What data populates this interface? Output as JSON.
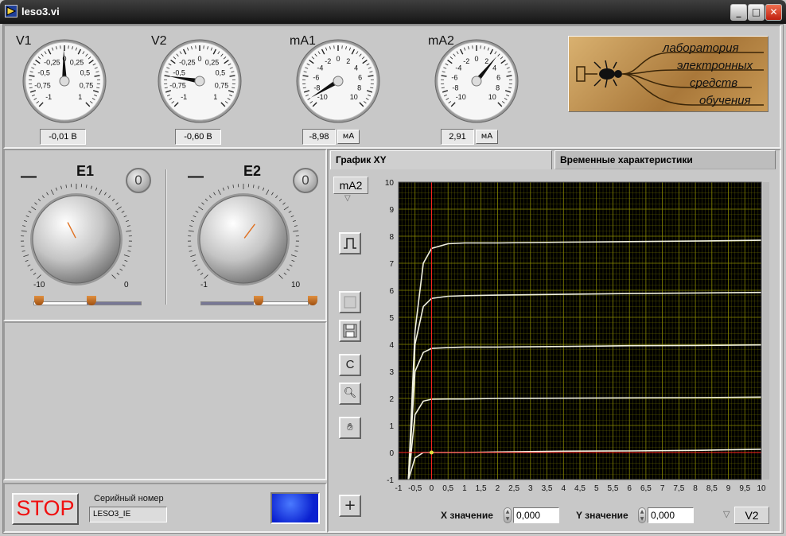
{
  "window": {
    "title": "leso3.vi",
    "minimize": "_",
    "maximize": "□",
    "close": "✕"
  },
  "gauges": [
    {
      "label": "V1",
      "ticks": [
        "-0,25",
        "0",
        "0,25",
        "-0,5",
        "0,5",
        "-0,75",
        "0,75",
        "-1",
        "1"
      ],
      "needle": -0.01,
      "min": -1,
      "max": 1,
      "display": "-0,01 В",
      "unit": ""
    },
    {
      "label": "V2",
      "ticks": [
        "-0,25",
        "0",
        "0,25",
        "-0,5",
        "0,5",
        "-0,75",
        "0,75",
        "-1",
        "1"
      ],
      "needle": -0.6,
      "min": -1,
      "max": 1,
      "display": "-0,60 В",
      "unit": ""
    },
    {
      "label": "mA1",
      "ticks": [
        "-2",
        "0",
        "2",
        "-4",
        "4",
        "-6",
        "6",
        "-8",
        "8",
        "-10",
        "10"
      ],
      "needle": -8.98,
      "min": -10,
      "max": 10,
      "display": "-8,98",
      "unit": "мА"
    },
    {
      "label": "mA2",
      "ticks": [
        "-2",
        "0",
        "2",
        "-4",
        "4",
        "-6",
        "6",
        "-8",
        "8",
        "-10",
        "10"
      ],
      "needle": 2.91,
      "min": -10,
      "max": 10,
      "display": "2,91",
      "unit": "мА"
    }
  ],
  "logo": {
    "lines": [
      "лаборатория",
      "электронных",
      "средств",
      "обучения"
    ]
  },
  "knobs": [
    {
      "label": "E1",
      "min_label": "-10",
      "max_label": "0",
      "reset": "0",
      "minus": "—",
      "value": -6
    },
    {
      "label": "E2",
      "min_label": "-1",
      "max_label": "10",
      "reset": "0",
      "minus": "—",
      "value": 6
    }
  ],
  "stop_label": "STOP",
  "serial": {
    "label": "Серийный номер",
    "value": "LESO3_IE"
  },
  "tabs": [
    {
      "label": "График XY"
    },
    {
      "label": "Временные характеристики"
    }
  ],
  "graph": {
    "y_channel": "mA2",
    "x_channel": "V2",
    "x_ticks": [
      "-1",
      "-0,5",
      "0",
      "0,5",
      "1",
      "1,5",
      "2",
      "2,5",
      "3",
      "3,5",
      "4",
      "4,5",
      "5",
      "5,5",
      "6",
      "6,5",
      "7",
      "7,5",
      "8",
      "8,5",
      "9",
      "9,5",
      "10"
    ],
    "y_ticks": [
      "-1",
      "0",
      "1",
      "2",
      "3",
      "4",
      "5",
      "6",
      "7",
      "8",
      "9",
      "10"
    ],
    "x_label": "X значение",
    "x_value": "0,000",
    "y_label": "Y значение",
    "y_value": "0,000",
    "colors": {
      "plot_bg": "#000000",
      "grid": "#8a8a00",
      "cursor": "#ff2020",
      "trace": "#f0f0e0"
    }
  },
  "chart_data": {
    "type": "line",
    "xlim": [
      -1,
      10
    ],
    "ylim": [
      -1,
      10
    ],
    "grid": true,
    "series": [
      {
        "x": [
          -0.7,
          -0.5,
          -0.25,
          0,
          0.5,
          1,
          2,
          4,
          6,
          8,
          10
        ],
        "y": [
          -1,
          4.5,
          7.0,
          7.55,
          7.72,
          7.75,
          7.75,
          7.78,
          7.8,
          7.82,
          7.85
        ]
      },
      {
        "x": [
          -0.7,
          -0.5,
          -0.25,
          0,
          0.5,
          1,
          2,
          4,
          6,
          8,
          10
        ],
        "y": [
          -1,
          4.0,
          5.4,
          5.7,
          5.78,
          5.8,
          5.82,
          5.85,
          5.88,
          5.9,
          5.92
        ]
      },
      {
        "x": [
          -0.7,
          -0.5,
          -0.25,
          0,
          0.5,
          1,
          2,
          4,
          6,
          8,
          10
        ],
        "y": [
          -1,
          3.0,
          3.7,
          3.85,
          3.88,
          3.9,
          3.9,
          3.92,
          3.95,
          3.96,
          3.98
        ]
      },
      {
        "x": [
          -0.7,
          -0.5,
          -0.25,
          0,
          0.5,
          1,
          2,
          4,
          6,
          8,
          10
        ],
        "y": [
          -1,
          1.4,
          1.9,
          1.97,
          1.98,
          1.98,
          2.0,
          2.01,
          2.02,
          2.03,
          2.05
        ]
      },
      {
        "x": [
          -0.7,
          -0.5,
          -0.25,
          0,
          1,
          2,
          4,
          6,
          8,
          9,
          10
        ],
        "y": [
          -1,
          -0.2,
          0,
          0,
          0,
          0.02,
          0.05,
          0.06,
          0.08,
          0.1,
          0.12
        ]
      }
    ]
  }
}
